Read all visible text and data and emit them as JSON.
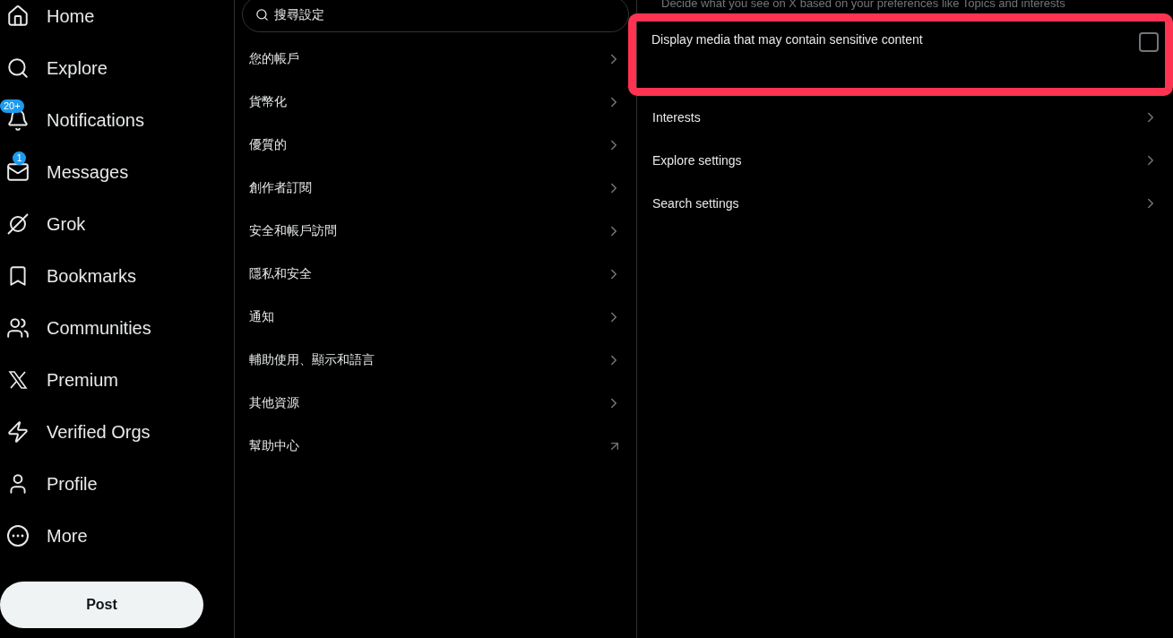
{
  "nav": [
    {
      "label": "Home"
    },
    {
      "label": "Explore"
    },
    {
      "label": "Notifications",
      "badge": "20+"
    },
    {
      "label": "Messages",
      "badge": "1"
    },
    {
      "label": "Grok"
    },
    {
      "label": "Bookmarks"
    },
    {
      "label": "Communities"
    },
    {
      "label": "Premium"
    },
    {
      "label": "Verified Orgs"
    },
    {
      "label": "Profile"
    },
    {
      "label": "More"
    }
  ],
  "post_button": "Post",
  "settings": {
    "search": {
      "placeholder": "搜尋設定"
    },
    "items": [
      {
        "label": "您的帳戶",
        "kind": "chevron"
      },
      {
        "label": "貨幣化",
        "kind": "chevron"
      },
      {
        "label": "優質的",
        "kind": "chevron"
      },
      {
        "label": "創作者訂閱",
        "kind": "chevron"
      },
      {
        "label": "安全和帳戶訪問",
        "kind": "chevron"
      },
      {
        "label": "隱私和安全",
        "kind": "chevron"
      },
      {
        "label": "通知",
        "kind": "chevron"
      },
      {
        "label": "輔助使用、顯示和語言",
        "kind": "chevron"
      },
      {
        "label": "其他資源",
        "kind": "chevron"
      },
      {
        "label": "幫助中心",
        "kind": "external"
      }
    ]
  },
  "detail": {
    "description": "Decide what you see on X based on your preferences like Topics and interests",
    "items": [
      {
        "label": "Display media that may contain sensitive content",
        "kind": "checkbox",
        "checked": false,
        "highlighted": true
      },
      {
        "label": "Interests",
        "kind": "link"
      },
      {
        "label": "Explore settings",
        "kind": "link"
      },
      {
        "label": "Search settings",
        "kind": "link"
      }
    ]
  }
}
